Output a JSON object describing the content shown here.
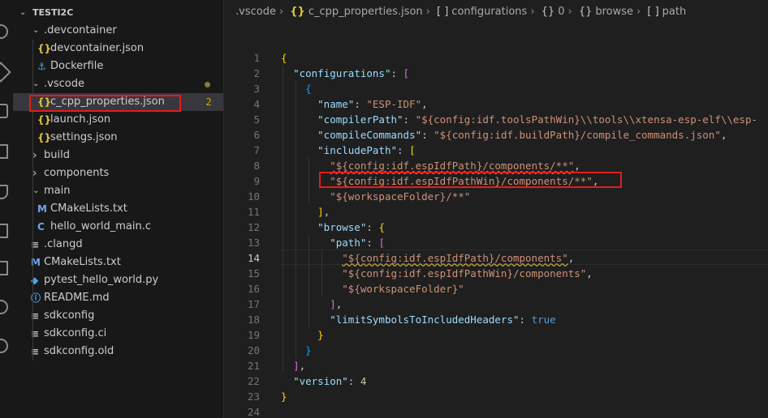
{
  "explorer": {
    "root_label": "TESTI2C",
    "rows": [
      {
        "label": ".devcontainer",
        "type": "folder-open",
        "depth": 1
      },
      {
        "label": "devcontainer.json",
        "type": "json",
        "depth": 2
      },
      {
        "label": "Dockerfile",
        "type": "docker",
        "depth": 2
      },
      {
        "label": ".vscode",
        "type": "folder-open",
        "depth": 1,
        "modified": true
      },
      {
        "label": "c_cpp_properties.json",
        "type": "json",
        "depth": 2,
        "badge": "2",
        "selected": true
      },
      {
        "label": "launch.json",
        "type": "json",
        "depth": 2
      },
      {
        "label": "settings.json",
        "type": "json",
        "depth": 2
      },
      {
        "label": "build",
        "type": "folder-closed",
        "depth": 1
      },
      {
        "label": "components",
        "type": "folder-closed",
        "depth": 1
      },
      {
        "label": "main",
        "type": "folder-open",
        "depth": 1
      },
      {
        "label": "CMakeLists.txt",
        "type": "cmake",
        "depth": 2
      },
      {
        "label": "hello_world_main.c",
        "type": "c",
        "depth": 2
      },
      {
        "label": ".clangd",
        "type": "text",
        "depth": 1
      },
      {
        "label": "CMakeLists.txt",
        "type": "cmake",
        "depth": 1
      },
      {
        "label": "pytest_hello_world.py",
        "type": "python",
        "depth": 1
      },
      {
        "label": "README.md",
        "type": "info",
        "depth": 1
      },
      {
        "label": "sdkconfig",
        "type": "text",
        "depth": 1
      },
      {
        "label": "sdkconfig.ci",
        "type": "text",
        "depth": 1
      },
      {
        "label": "sdkconfig.old",
        "type": "text",
        "depth": 1
      }
    ]
  },
  "breadcrumb": {
    "items": [
      ".vscode",
      "c_cpp_properties.json",
      "configurations",
      "0",
      "browse",
      "path"
    ]
  },
  "editor": {
    "active_line": "14",
    "line_numbers": [
      "1",
      "2",
      "3",
      "4",
      "5",
      "6",
      "7",
      "8",
      "9",
      "10",
      "11",
      "12",
      "13",
      "14",
      "15",
      "16",
      "17",
      "18",
      "19",
      "20",
      "21",
      "22",
      "23",
      "24"
    ],
    "tokens": {
      "l2_key": "\"configurations\"",
      "l4_key": "\"name\"",
      "l4_val": "\"ESP-IDF\"",
      "l5_key": "\"compilerPath\"",
      "l5_val": "\"${config:idf.toolsPathWin}\\\\tools\\\\xtensa-esp-elf\\\\esp-",
      "l6_key": "\"compileCommands\"",
      "l6_val": "\"${config:idf.buildPath}/compile_commands.json\"",
      "l7_key": "\"includePath\"",
      "l8_val": "\"${config:idf.espIdfPath}/components/**\"",
      "l9_val": "\"${config:idf.espIdfPathWin}/components/**\"",
      "l10_val": "\"${workspaceFolder}/**\"",
      "l12_key": "\"browse\"",
      "l13_key": "\"path\"",
      "l14_val": "\"${config:idf.espIdfPath}/components\"",
      "l15_val": "\"${config:idf.espIdfPathWin}/components\"",
      "l16_val": "\"${workspaceFolder}\"",
      "l18_key": "\"limitSymbolsToIncludedHeaders\"",
      "l18_val": "true",
      "l22_key": "\"version\"",
      "l22_val": "4"
    }
  },
  "colors": {
    "highlight_box": "#e51c1c",
    "json_icon": "#e2c541",
    "badge": "#cca700"
  }
}
